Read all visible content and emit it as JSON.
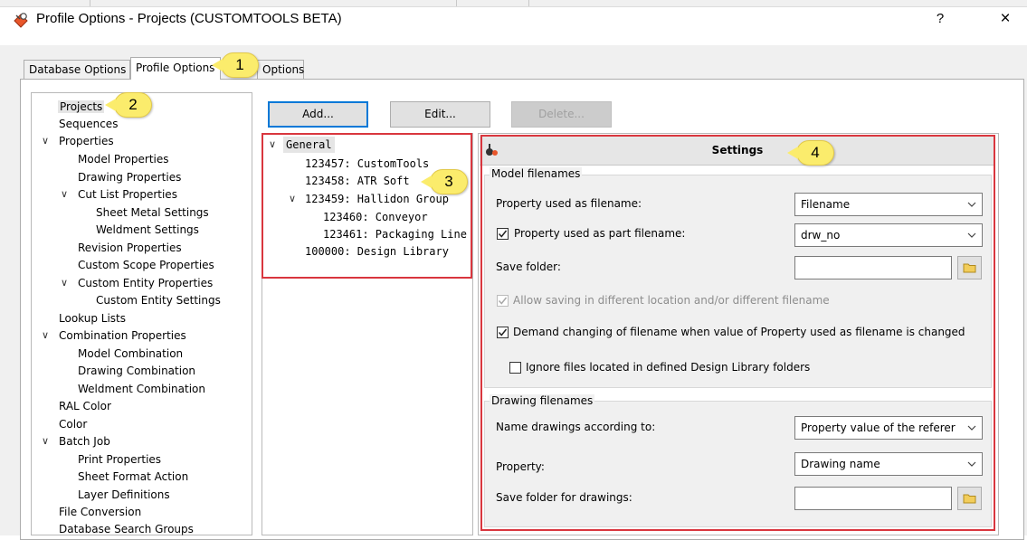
{
  "window": {
    "title": "Profile Options - Projects (CUSTOMTOOLS BETA)",
    "help_label": "?",
    "close_label": "×"
  },
  "tabs": [
    {
      "label": "Database Options"
    },
    {
      "label": "Profile Options"
    },
    {
      "label": "Options"
    }
  ],
  "callouts": [
    "1",
    "2",
    "3",
    "4"
  ],
  "sidebar": {
    "items": [
      {
        "label": "Projects",
        "selected": true
      },
      {
        "label": "Sequences"
      },
      {
        "label": "Properties",
        "expanded": true
      },
      {
        "label": "Model Properties"
      },
      {
        "label": "Drawing Properties"
      },
      {
        "label": "Cut List Properties",
        "expanded": true
      },
      {
        "label": "Sheet Metal Settings"
      },
      {
        "label": "Weldment Settings"
      },
      {
        "label": "Revision Properties"
      },
      {
        "label": "Custom Scope Properties"
      },
      {
        "label": "Custom Entity Properties",
        "expanded": true
      },
      {
        "label": "Custom Entity Settings"
      },
      {
        "label": "Lookup Lists"
      },
      {
        "label": "Combination Properties",
        "expanded": true
      },
      {
        "label": "Model Combination"
      },
      {
        "label": "Drawing Combination"
      },
      {
        "label": "Weldment Combination"
      },
      {
        "label": "RAL Color"
      },
      {
        "label": "Color"
      },
      {
        "label": "Batch Job",
        "expanded": true
      },
      {
        "label": "Print Properties"
      },
      {
        "label": "Sheet Format Action"
      },
      {
        "label": "Layer Definitions"
      },
      {
        "label": "File Conversion"
      },
      {
        "label": "Database Search Groups"
      }
    ]
  },
  "toolbar": {
    "add_label": "Add...",
    "edit_label": "Edit...",
    "delete_label": "Delete..."
  },
  "projects": {
    "items": [
      {
        "label": "General"
      },
      {
        "label": "123457: CustomTools"
      },
      {
        "label": "123458: ATR Soft"
      },
      {
        "label": "123459: Hallidon Group"
      },
      {
        "label": "123460: Conveyor"
      },
      {
        "label": "123461: Packaging Line"
      },
      {
        "label": "100000: Design Library"
      }
    ]
  },
  "settings": {
    "title": "Settings",
    "model_group": {
      "legend": "Model filenames",
      "property_filename_label": "Property used as filename:",
      "property_filename_value": "Filename",
      "part_filename_label": "Property used as part filename:",
      "part_filename_checked": true,
      "part_filename_value": "drw_no",
      "save_folder_label": "Save folder:",
      "save_folder_value": "",
      "allow_saving_label": "Allow saving in different location and/or different filename",
      "allow_saving_checked": true,
      "demand_changing_label": "Demand changing of filename when value of Property used as filename is changed",
      "demand_changing_checked": true,
      "ignore_files_label": "Ignore files located in defined Design Library folders",
      "ignore_files_checked": false
    },
    "drawing_group": {
      "legend": "Drawing filenames",
      "name_drawings_label": "Name drawings according to:",
      "name_drawings_value": "Property value of the referer",
      "property_label": "Property:",
      "property_value": "Drawing name",
      "save_folder_label": "Save folder for drawings:",
      "save_folder_value": ""
    }
  },
  "colors": {
    "highlight_frame": "#d9363e",
    "callout": "#fbec6c",
    "primary_border": "#0078d7"
  }
}
